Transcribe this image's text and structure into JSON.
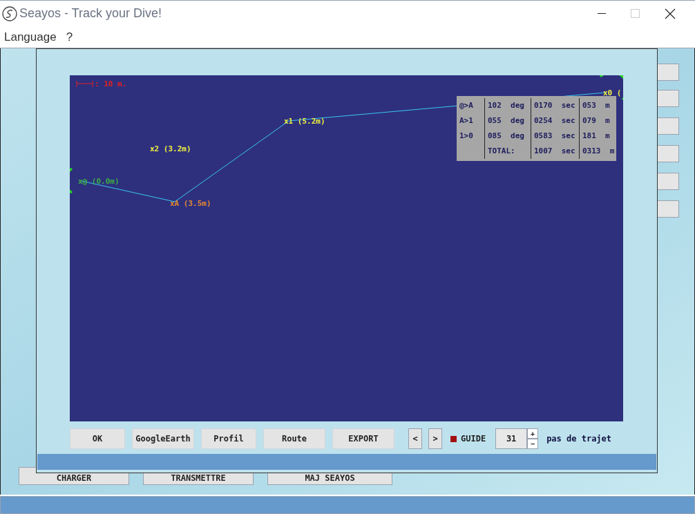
{
  "window": {
    "title": "Seayos - Track your Dive!"
  },
  "menu": [
    "Language",
    "?"
  ],
  "background_buttons": [
    "CHARGER",
    "TRANSMETTRE",
    "MAJ SEAYOS"
  ],
  "map": {
    "scale_label": ": 10 m.",
    "points": [
      {
        "kind": "route",
        "label": "x@ (0.0m)",
        "color": "#3cb043"
      },
      {
        "kind": "route",
        "label": "xA (3.5m)",
        "color": "#e8892f"
      },
      {
        "kind": "marker",
        "label": "x2 (3.2m)",
        "color": "#f2f23c"
      },
      {
        "kind": "route",
        "label": "x1 (5.2m)",
        "color": "#f2f23c"
      },
      {
        "kind": "route",
        "label": "x0 (",
        "color": "#f2f23c"
      }
    ],
    "table": [
      {
        "leg": "@>A",
        "bearing": "102  deg",
        "time": "0170  sec",
        "distance": "053  m"
      },
      {
        "leg": "A>1",
        "bearing": "055  deg",
        "time": "0254  sec",
        "distance": "079  m"
      },
      {
        "leg": "1>0",
        "bearing": "085  deg",
        "time": "0583  sec",
        "distance": "181  m"
      },
      {
        "bearing": "TOTAL:",
        "time": "1007  sec",
        "distance": "0313  m"
      }
    ]
  },
  "buttons": [
    "OK",
    "GoogleEarth",
    "Profil",
    "Route",
    "EXPORT"
  ],
  "nav": [
    "<",
    ">"
  ],
  "guide": {
    "label": "GUIDE",
    "checked": true
  },
  "spinner": {
    "value": "31",
    "up": "+",
    "down": "−"
  },
  "hint": "pas de trajet"
}
